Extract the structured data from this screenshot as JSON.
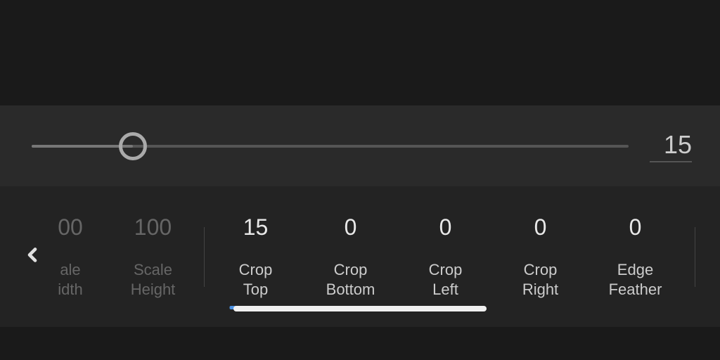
{
  "slider": {
    "value": "15",
    "position_percent": 17
  },
  "params": [
    {
      "value": "00",
      "label": "ale\nidth",
      "dimmed": true,
      "partial": true
    },
    {
      "value": "100",
      "label": "Scale\nHeight",
      "dimmed": true
    },
    {
      "value": "15",
      "label": "Crop\nTop",
      "active": true
    },
    {
      "value": "0",
      "label": "Crop\nBottom"
    },
    {
      "value": "0",
      "label": "Crop\nLeft"
    },
    {
      "value": "0",
      "label": "Crop\nRight"
    },
    {
      "value": "0",
      "label": "Edge\nFeather"
    }
  ]
}
